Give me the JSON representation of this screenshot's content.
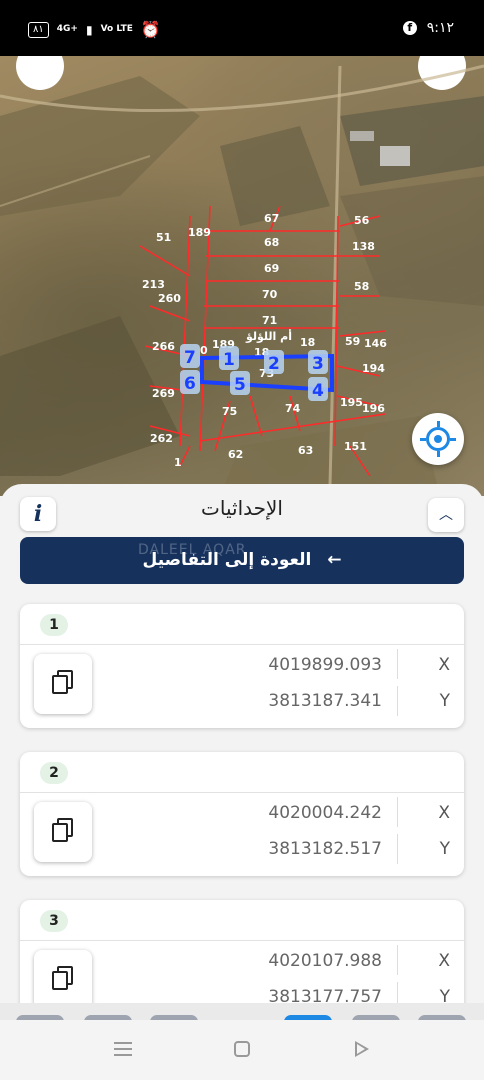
{
  "status_bar": {
    "battery": "٨١",
    "network": "4G+",
    "network2": "Vo LTE",
    "signal_icon": "signal-bars-icon",
    "alarm_icon": "alarm-clock-icon",
    "facebook_icon": "facebook-icon",
    "time": "٩:١٢"
  },
  "map": {
    "parcel_labels": [
      "67",
      "56",
      "51",
      "189",
      "68",
      "138",
      "69",
      "213",
      "58",
      "260",
      "70",
      "71",
      "266",
      "189",
      "59",
      "146",
      "18",
      "194",
      "269",
      "73",
      "75",
      "74",
      "195",
      "196",
      "262",
      "63",
      "151",
      "1",
      "62",
      "0",
      "18"
    ],
    "area_name": "أم اللؤلؤ",
    "corner_numbers": [
      "1",
      "2",
      "3",
      "4",
      "5",
      "6",
      "7"
    ],
    "highlight_color": "#1a3fff",
    "line_color": "#ff2a2a",
    "locate_icon": "my-location-icon"
  },
  "sheet": {
    "info_label": "i",
    "title": "الإحداثيات",
    "collapse_icon": "chevron-up-icon",
    "back_button": "العودة إلى التفاصيل",
    "back_arrow": "←",
    "watermark": "DALEEL AQAR"
  },
  "coordinates": [
    {
      "index": "1",
      "x_label": "X",
      "y_label": "Y",
      "x": "4019899.093",
      "y": "3813187.341"
    },
    {
      "index": "2",
      "x_label": "X",
      "y_label": "Y",
      "x": "4020004.242",
      "y": "3813182.517"
    },
    {
      "index": "3",
      "x_label": "X",
      "y_label": "Y",
      "x": "4020107.988",
      "y": "3813177.757"
    }
  ],
  "colors": {
    "primary": "#16325c",
    "badge": "#e3f2e5"
  }
}
